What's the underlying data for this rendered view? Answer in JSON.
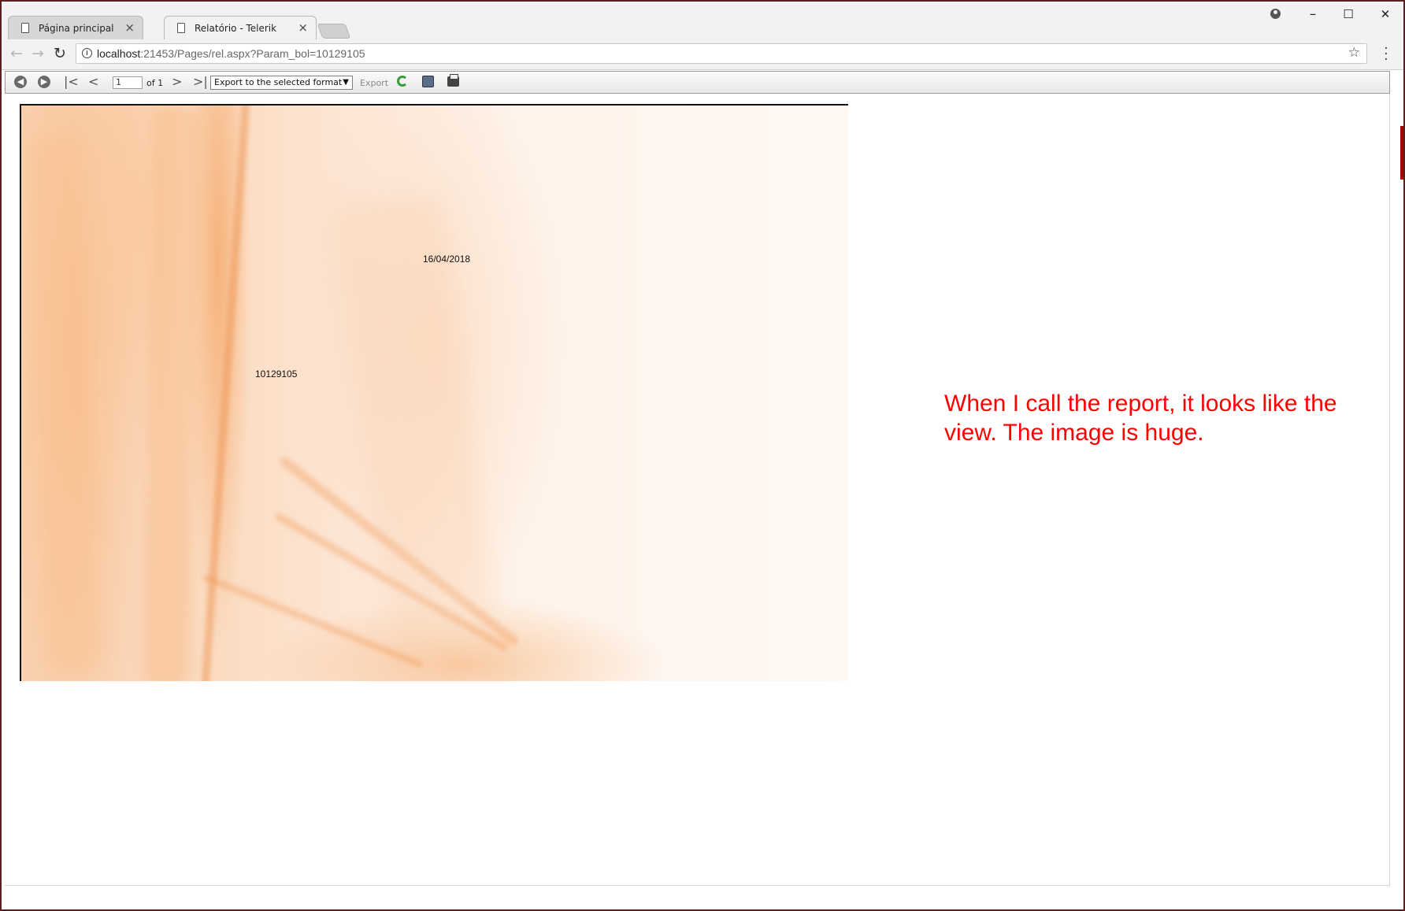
{
  "browser": {
    "tabs": [
      {
        "label": "Página principal",
        "close": "×",
        "active": false
      },
      {
        "label": "Relatório - Telerik",
        "close": "×",
        "active": true
      }
    ],
    "window_controls": {
      "minimize": "–",
      "maximize": "☐",
      "close": "✕"
    },
    "address": {
      "host": "localhost",
      "path": ":21453/Pages/rel.aspx?Param_bol=10129105"
    }
  },
  "viewer_toolbar": {
    "page_number": "1",
    "page_of": "of 1",
    "export_format": "Export to the selected format",
    "export_label": "Export"
  },
  "report": {
    "date": "16/04/2018",
    "param": "10129105"
  },
  "annotation": {
    "text": "When I call the report, it looks like the view. The image is huge.",
    "color": "#ff0000"
  },
  "colors": {
    "accent": "#f7b27a",
    "frame": "#5a1f1f"
  }
}
